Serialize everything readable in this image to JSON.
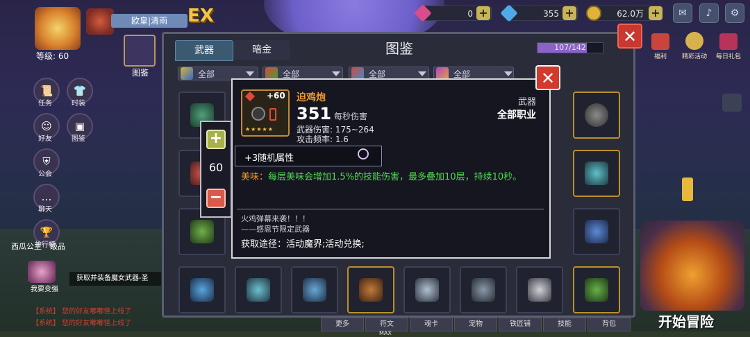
{
  "player": {
    "name": "欧皇|清雨",
    "level_label": "等级: 60",
    "ex_badge": "EX"
  },
  "resources": [
    {
      "icon": "pink-gem-icon",
      "value": "0",
      "color": "#d84d8a"
    },
    {
      "icon": "blue-diamond-icon",
      "value": "355",
      "color": "#4fa9e8"
    },
    {
      "icon": "gold-coin-icon",
      "value": "62.0万",
      "color": "#e0b43a"
    }
  ],
  "top_icons": [
    "mail-icon",
    "speaker-icon",
    "settings-icon"
  ],
  "left_menu": [
    {
      "label": "任务",
      "icon": "scroll-icon"
    },
    {
      "label": "时装",
      "icon": "costume-icon"
    },
    {
      "label": "好友",
      "icon": "friends-icon"
    },
    {
      "label": "图鉴",
      "icon": "codex-icon"
    },
    {
      "label": "公会",
      "icon": "guild-icon"
    },
    {
      "label": "聊天",
      "icon": "chat-icon"
    },
    {
      "label": "排行榜",
      "icon": "trophy-icon"
    }
  ],
  "codex_button_label": "图鉴",
  "right_menu": [
    {
      "label": "福利",
      "icon": "gift-icon"
    },
    {
      "label": "精彩活动",
      "icon": "event-icon"
    },
    {
      "label": "每日礼包",
      "icon": "daily-gift-icon"
    }
  ],
  "panel": {
    "title": "图鉴",
    "tabs": [
      "武器",
      "暗金"
    ],
    "progress": "107/142",
    "progress_fraction": 0.754,
    "filters": [
      "全部",
      "全部",
      "全部",
      "全部"
    ]
  },
  "detail": {
    "name": "迫鸡炮",
    "enhance": "+60",
    "dps": "351",
    "dps_label": "每秒伤害",
    "damage": "武器伤害: 175~264",
    "attack_rate": "攻击频率: 1.6",
    "category": "武器",
    "job": "全部职业",
    "stars": "★★★★★",
    "random_attr": "+3随机属性",
    "effect_label": "美味：",
    "effect_text": "每层美味会增加1.5%的技能伤害，最多叠加10层，持续10秒。",
    "flavor": "火鸡弹幕来袭！！！",
    "flavor2": "——感恩节限定武器",
    "source": "获取途径：活动魔界;活动兑换;"
  },
  "stepper": {
    "value": "60",
    "plus": "+",
    "minus": "−"
  },
  "side_text": {
    "name_label": "西瓜公主",
    "extra": "级品",
    "mission": "获取并装备魔女武器-圣",
    "change": "我要变强"
  },
  "chat": [
    "【系统】 您的好友嘟嘟怪上线了",
    "【系统】 您的好友嘟嘟怪上线了"
  ],
  "bottom_tabs": [
    "更多",
    "符文",
    "魂卡",
    "宠物",
    "铁匠铺",
    "技能",
    "背包"
  ],
  "bottom_max": "MAX",
  "start_label": "开始冒险"
}
